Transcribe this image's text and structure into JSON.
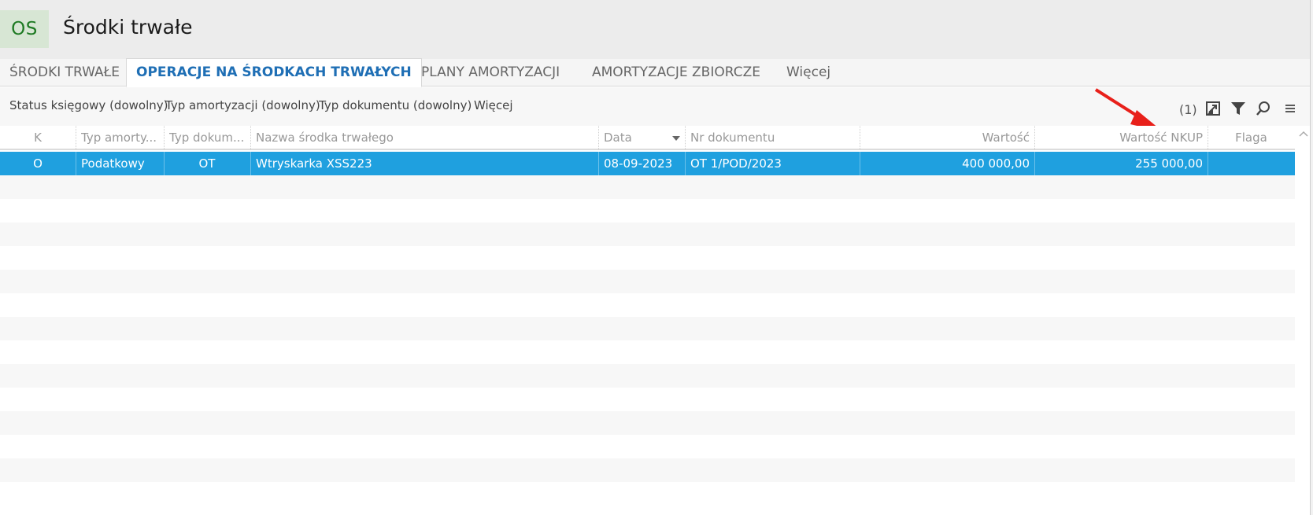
{
  "app": {
    "badge": "OS",
    "title": "Środki trwałe"
  },
  "tabs": [
    {
      "label": "ŚRODKI TRWAŁE"
    },
    {
      "label": "OPERACJE NA ŚRODKACH TRWAŁYCH"
    },
    {
      "label": "PLANY AMORTYZACJI"
    },
    {
      "label": "AMORTYZACJE ZBIORCZE"
    },
    {
      "label": "Więcej"
    }
  ],
  "active_tab": "OPERACJE NA ŚRODKACH TRWAŁYCH",
  "filters": [
    {
      "label": "Status księgowy (dowolny)"
    },
    {
      "label": "Typ amortyzacji (dowolny)"
    },
    {
      "label": "Typ dokumentu (dowolny)"
    },
    {
      "label": "Więcej"
    }
  ],
  "toolbar": {
    "count": "(1)",
    "icons": [
      "export-icon",
      "filter-icon",
      "search-icon",
      "menu-icon"
    ]
  },
  "columns": [
    "K",
    "Typ amorty...",
    "Typ dokum...",
    "Nazwa środka trwałego",
    "Data",
    "Nr dokumentu",
    "Wartość",
    "Wartość NKUP",
    "Flaga"
  ],
  "rows": [
    {
      "k": "O",
      "typ_amortyzacji": "Podatkowy",
      "typ_dokumentu": "OT",
      "nazwa": "Wtryskarka XSS223",
      "data": "08-09-2023",
      "nr_dokumentu": "OT 1/POD/2023",
      "wartosc": "400 000,00",
      "wartosc_nkup": "255 000,00",
      "flaga": ""
    }
  ],
  "colors": {
    "selected_row": "#1fa0df",
    "active_tab_text": "#1f6fb5",
    "badge_bg": "#d7e6d4",
    "badge_text": "#1e7a23",
    "annotation_arrow": "#e8201a"
  }
}
